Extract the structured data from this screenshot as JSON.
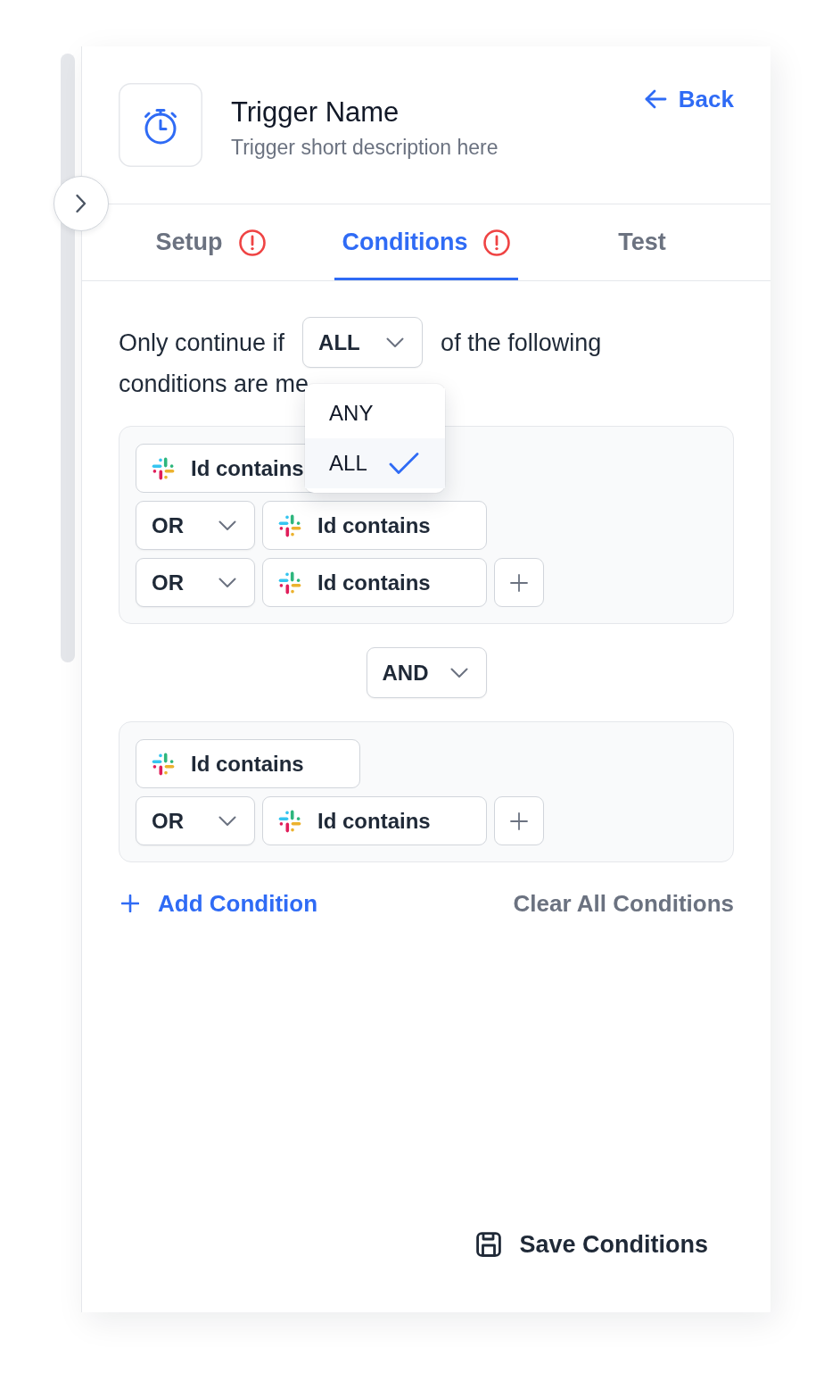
{
  "header": {
    "title": "Trigger Name",
    "description": "Trigger short description here",
    "back_link": "Back"
  },
  "tabs": [
    {
      "label": "Setup",
      "selected": false,
      "warning": true
    },
    {
      "label": "Conditions",
      "selected": true,
      "warning": true
    },
    {
      "label": "Test",
      "selected": false,
      "warning": false
    }
  ],
  "match_rule": {
    "text_before": "Only continue if",
    "text_after": "of the following",
    "text_second_line": "conditions are me",
    "select": {
      "value": "ALL",
      "expanded": true,
      "options": [
        {
          "label": "ANY",
          "selected": false
        },
        {
          "label": "ALL",
          "selected": true
        }
      ]
    }
  },
  "groups": [
    {
      "rows": [
        {
          "condition": "Id contains"
        },
        {
          "operator": "OR",
          "condition": "Id contains"
        },
        {
          "operator": "OR",
          "condition": "Id contains",
          "add_button": true
        }
      ]
    },
    {
      "rows": [
        {
          "condition": "Id contains"
        },
        {
          "operator": "OR",
          "condition": "Id contains",
          "add_button": true
        }
      ]
    }
  ],
  "group_joiners": [
    {
      "operator": "AND"
    }
  ],
  "actions": {
    "add_condition": "Add Condition",
    "clear_all": "Clear All Conditions"
  },
  "footer": {
    "save_button": "Save Conditions"
  }
}
